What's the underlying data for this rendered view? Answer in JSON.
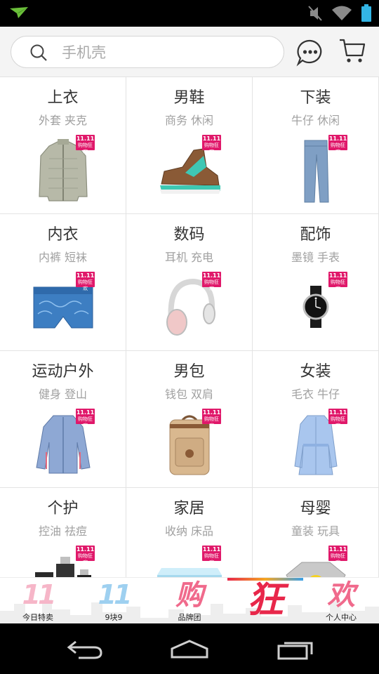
{
  "search": {
    "placeholder": "手机壳"
  },
  "categories": [
    {
      "title": "上衣",
      "sub": "外套 夹克",
      "icon": "jacket"
    },
    {
      "title": "男鞋",
      "sub": "商务 休闲",
      "icon": "sneaker"
    },
    {
      "title": "下装",
      "sub": "牛仔 休闲",
      "icon": "jeans"
    },
    {
      "title": "内衣",
      "sub": "内裤 短袜",
      "icon": "underwear"
    },
    {
      "title": "数码",
      "sub": "耳机 充电",
      "icon": "headphones"
    },
    {
      "title": "配饰",
      "sub": "墨镜 手表",
      "icon": "watch"
    },
    {
      "title": "运动户外",
      "sub": "健身 登山",
      "icon": "windbreaker"
    },
    {
      "title": "男包",
      "sub": "钱包 双肩",
      "icon": "backpack"
    },
    {
      "title": "女装",
      "sub": "毛衣 牛仔",
      "icon": "coat"
    },
    {
      "title": "个护",
      "sub": "控油 祛痘",
      "icon": "bottles"
    },
    {
      "title": "家居",
      "sub": "收纳 床品",
      "icon": "bedding"
    },
    {
      "title": "母婴",
      "sub": "童装 玩具",
      "icon": "kids-sweater"
    }
  ],
  "badge": {
    "line1": "11.11",
    "line2": "购物狂欢"
  },
  "tabs": [
    {
      "big": "11",
      "label": "今日特卖"
    },
    {
      "big": "11",
      "label": "9块9"
    },
    {
      "big": "购",
      "label": "品牌团"
    },
    {
      "big": "狂",
      "label": ""
    },
    {
      "big": "欢",
      "label": "个人中心"
    }
  ],
  "colors": {
    "badge": "#e0186a",
    "promo_red": "#e8274a",
    "promo_pink": "#f06a8c"
  }
}
